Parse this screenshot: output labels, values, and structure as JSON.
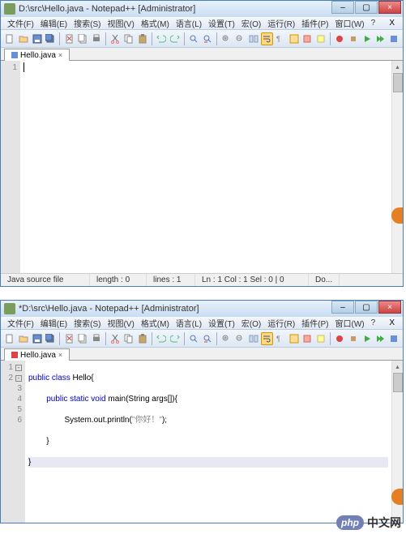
{
  "win1": {
    "title": "D:\\src\\Hello.java - Notepad++ [Administrator]",
    "tab": "Hello.java",
    "code_lines": [
      "1"
    ],
    "code_content": "",
    "status": {
      "type": "Java source file",
      "length": "length : 0",
      "lines": "lines : 1",
      "pos": "Ln : 1   Col : 1   Sel : 0 | 0",
      "encoding": "Do..."
    }
  },
  "win2": {
    "title": "*D:\\src\\Hello.java - Notepad++ [Administrator]",
    "tab": "Hello.java",
    "code_lines": [
      "1",
      "2",
      "3",
      "4",
      "5",
      "6"
    ],
    "code": {
      "l1_kw": "public class",
      "l1_cls": " Hello{",
      "l2_kw": "public static void",
      "l2_rest": " main(String args[]){",
      "l3_a": "                System.out.println(",
      "l3_str": "\"你好！\"",
      "l3_b": ");",
      "l4": "        }",
      "l5": "}"
    }
  },
  "menus": [
    "文件(F)",
    "编辑(E)",
    "搜索(S)",
    "视图(V)",
    "格式(M)",
    "语言(L)",
    "设置(T)",
    "宏(O)",
    "运行(R)",
    "插件(P)",
    "窗口(W)",
    "?"
  ],
  "watermark": {
    "logo": "php",
    "text": "中文网"
  },
  "winbtn": {
    "min": "–",
    "max": "▢",
    "close": "×"
  }
}
